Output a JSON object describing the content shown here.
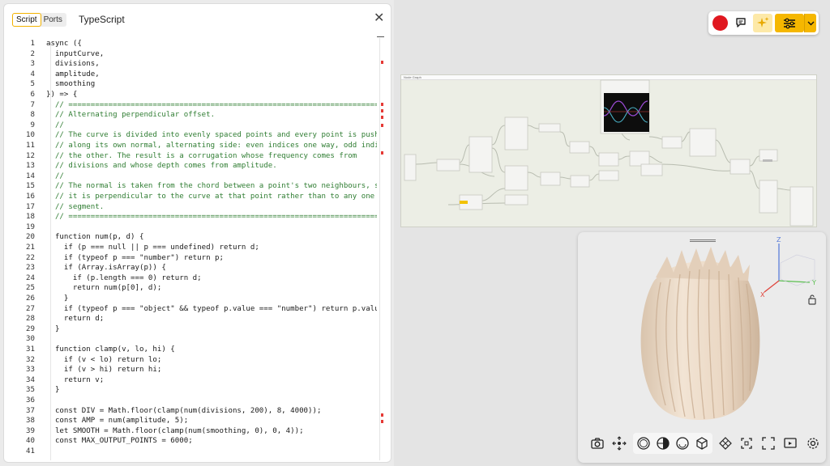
{
  "editor": {
    "tabs": [
      {
        "label": "Script",
        "active": true
      },
      {
        "label": "Ports",
        "active": false
      }
    ],
    "language": "TypeScript",
    "close_icon": "close-icon",
    "lines": [
      {
        "n": "1",
        "t": "async ({",
        "c": false
      },
      {
        "n": "2",
        "t": "  inputCurve,",
        "c": false
      },
      {
        "n": "3",
        "t": "  divisions,",
        "c": false
      },
      {
        "n": "4",
        "t": "  amplitude,",
        "c": false
      },
      {
        "n": "5",
        "t": "  smoothing",
        "c": false
      },
      {
        "n": "6",
        "t": "}) => {",
        "c": false
      },
      {
        "n": "7",
        "t": "  // ======================================================================",
        "c": true
      },
      {
        "n": "8",
        "t": "  // Alternating perpendicular offset.",
        "c": true
      },
      {
        "n": "9",
        "t": "  //",
        "c": true
      },
      {
        "n": "10",
        "t": "  // The curve is divided into evenly spaced points and every point is pushed",
        "c": true
      },
      {
        "n": "11",
        "t": "  // along its own normal, alternating side: even indices one way, odd indices",
        "c": true
      },
      {
        "n": "12",
        "t": "  // the other. The result is a corrugation whose frequency comes from",
        "c": true
      },
      {
        "n": "13",
        "t": "  // divisions and whose depth comes from amplitude.",
        "c": true
      },
      {
        "n": "14",
        "t": "  //",
        "c": true
      },
      {
        "n": "15",
        "t": "  // The normal is taken from the chord between a point's two neighbours, so",
        "c": true
      },
      {
        "n": "16",
        "t": "  // it is perpendicular to the curve at that point rather than to any one",
        "c": true
      },
      {
        "n": "17",
        "t": "  // segment.",
        "c": true
      },
      {
        "n": "18",
        "t": "  // ======================================================================",
        "c": true
      },
      {
        "n": "19",
        "t": "",
        "c": false
      },
      {
        "n": "20",
        "t": "  function num(p, d) {",
        "c": false
      },
      {
        "n": "21",
        "t": "    if (p === null || p === undefined) return d;",
        "c": false
      },
      {
        "n": "22",
        "t": "    if (typeof p === \"number\") return p;",
        "c": false
      },
      {
        "n": "23",
        "t": "    if (Array.isArray(p)) {",
        "c": false
      },
      {
        "n": "24",
        "t": "      if (p.length === 0) return d;",
        "c": false
      },
      {
        "n": "25",
        "t": "      return num(p[0], d);",
        "c": false
      },
      {
        "n": "26",
        "t": "    }",
        "c": false
      },
      {
        "n": "27",
        "t": "    if (typeof p === \"object\" && typeof p.value === \"number\") return p.value;",
        "c": false
      },
      {
        "n": "28",
        "t": "    return d;",
        "c": false
      },
      {
        "n": "29",
        "t": "  }",
        "c": false
      },
      {
        "n": "30",
        "t": "",
        "c": false
      },
      {
        "n": "31",
        "t": "  function clamp(v, lo, hi) {",
        "c": false
      },
      {
        "n": "32",
        "t": "    if (v < lo) return lo;",
        "c": false
      },
      {
        "n": "33",
        "t": "    if (v > hi) return hi;",
        "c": false
      },
      {
        "n": "34",
        "t": "    return v;",
        "c": false
      },
      {
        "n": "35",
        "t": "  }",
        "c": false
      },
      {
        "n": "36",
        "t": "",
        "c": false
      },
      {
        "n": "37",
        "t": "  const DIV = Math.floor(clamp(num(divisions, 200), 8, 4000));",
        "c": false
      },
      {
        "n": "38",
        "t": "  const AMP = num(amplitude, 5);",
        "c": false
      },
      {
        "n": "39",
        "t": "  let SMOOTH = Math.floor(clamp(num(smoothing, 0), 0, 4));",
        "c": false
      },
      {
        "n": "40",
        "t": "  const MAX_OUTPUT_POINTS = 6000;",
        "c": false
      },
      {
        "n": "41",
        "t": "",
        "c": false
      }
    ]
  },
  "toolbar": {
    "record_icon": "record-icon",
    "chat_icon": "chat-icon",
    "ai_icon": "sparkle-icon",
    "settings_icon": "sliders-icon",
    "dropdown_icon": "chevron-down-icon"
  },
  "graph": {
    "title": "Node Graph"
  },
  "viewport": {
    "tools": [
      "camera-icon",
      "orbit-icon",
      "shaded-sphere-icon",
      "half-shaded-sphere-icon",
      "smooth-sphere-icon",
      "cube-icon",
      "diamond-icon",
      "frame-selection-icon",
      "fullscreen-icon",
      "screen-icon",
      "gear-icon"
    ]
  },
  "colors": {
    "accent": "#f5b700",
    "record": "#e0171f",
    "comment": "#2f7d32",
    "graph_bg": "#eceee5",
    "model": "#eadbcb"
  }
}
